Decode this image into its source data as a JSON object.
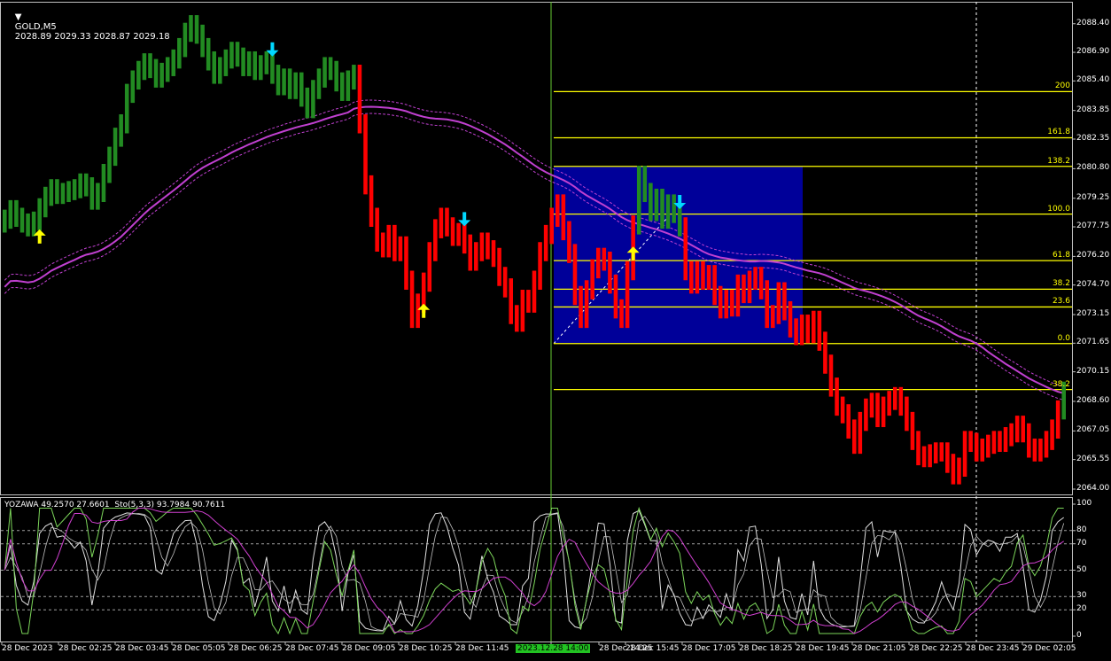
{
  "header": {
    "symbol": "GOLD,M5",
    "ohlc": "2028.89 2029.33 2028.87 2029.18"
  },
  "indicator_header": "YOZAWA 49.2570 27.6601  Sto(5,3,3) 93.7984 90.7611",
  "price_axis": [
    "2088.40",
    "2086.90",
    "2085.40",
    "2083.85",
    "2082.35",
    "2080.80",
    "2079.25",
    "2077.75",
    "2076.20",
    "2074.70",
    "2073.15",
    "2071.65",
    "2070.15",
    "2068.60",
    "2067.05",
    "2065.55",
    "2064.00"
  ],
  "osc_axis": [
    "100",
    "80",
    "70",
    "50",
    "30",
    "20",
    "0"
  ],
  "fib_levels": [
    {
      "label": "200",
      "price": 2084.84
    },
    {
      "label": "161.8",
      "price": 2082.42
    },
    {
      "label": "138.2",
      "price": 2080.92
    },
    {
      "label": "100.0",
      "price": 2078.42
    },
    {
      "label": "61.8",
      "price": 2075.98
    },
    {
      "label": "38.2",
      "price": 2074.48
    },
    {
      "label": "23.6",
      "price": 2073.55
    },
    {
      "label": "0.0",
      "price": 2071.63
    },
    {
      "label": "-38.2",
      "price": 2069.22
    }
  ],
  "time_axis": [
    "28 Dec 2023",
    "28 Dec 02:25",
    "28 Dec 03:45",
    "28 Dec 05:05",
    "28 Dec 06:25",
    "28 Dec 07:45",
    "28 Dec 09:05",
    "28 Dec 10:25",
    "28 Dec 11:45",
    "2023.12.28 14:00",
    "28 Dec 14:25",
    "28 Dec 15:45",
    "28 Dec 17:05",
    "28 Dec 18:25",
    "28 Dec 19:45",
    "28 Dec 21:05",
    "28 Dec 22:25",
    "28 Dec 23:45",
    "29 Dec 02:05"
  ],
  "colors": {
    "bull": "#228b22",
    "bear": "#ff0000",
    "ma": "#c040d0",
    "fib": "#ffff00",
    "box": "#000099",
    "vline": "#66cc33",
    "grid": "#c0c0c0"
  },
  "signals": [
    {
      "type": "buy",
      "color": "#ffff00",
      "bar": 6
    },
    {
      "type": "sell",
      "color": "#00d8ff",
      "bar": 46
    },
    {
      "type": "buy",
      "color": "#ffff00",
      "bar": 72
    },
    {
      "type": "sell",
      "color": "#00d8ff",
      "bar": 79
    },
    {
      "type": "buy",
      "color": "#ffff00",
      "bar": 108
    },
    {
      "type": "sell",
      "color": "#00d8ff",
      "bar": 116
    }
  ],
  "chart_data": {
    "type": "candlestick",
    "ylim": [
      2064.0,
      2088.9
    ],
    "osc_ylim": [
      0,
      100
    ],
    "closes": [
      2078.2,
      2078.7,
      2078.3,
      2078.0,
      2077.8,
      2078.1,
      2078.8,
      2079.4,
      2079.8,
      2079.5,
      2079.6,
      2079.7,
      2079.8,
      2080.1,
      2079.9,
      2079.2,
      2079.6,
      2080.6,
      2081.5,
      2082.5,
      2083.2,
      2084.8,
      2085.5,
      2086.0,
      2086.4,
      2086.1,
      2085.6,
      2085.9,
      2086.2,
      2086.6,
      2087.2,
      2088.0,
      2088.4,
      2087.9,
      2087.2,
      2086.5,
      2085.8,
      2086.2,
      2086.6,
      2087.0,
      2086.7,
      2086.2,
      2086.5,
      2086.0,
      2086.3,
      2086.5,
      2085.8,
      2085.2,
      2085.6,
      2085.0,
      2085.4,
      2084.6,
      2084.0,
      2085.0,
      2085.6,
      2086.2,
      2086.0,
      2085.4,
      2084.9,
      2085.5,
      2085.8,
      2083.2,
      2080.0,
      2078.3,
      2077.0,
      2076.7,
      2077.4,
      2076.5,
      2076.8,
      2075.0,
      2073.0,
      2073.8,
      2074.9,
      2076.5,
      2077.7,
      2078.3,
      2077.8,
      2077.3,
      2077.5,
      2076.9,
      2076.0,
      2076.5,
      2077.0,
      2076.6,
      2076.2,
      2075.2,
      2074.6,
      2073.2,
      2072.8,
      2074.0,
      2073.8,
      2075.0,
      2076.5,
      2077.4,
      2078.3,
      2079.0,
      2077.6,
      2076.4,
      2074.2,
      2073.0,
      2074.5,
      2075.6,
      2076.2,
      2076.0,
      2074.8,
      2073.5,
      2073.0,
      2075.5,
      2077.9,
      2080.5,
      2079.6,
      2078.6,
      2079.3,
      2078.2,
      2079.0,
      2078.5,
      2077.8,
      2075.5,
      2074.8,
      2075.5,
      2075.0,
      2075.3,
      2074.2,
      2073.5,
      2074.0,
      2073.6,
      2074.8,
      2074.3,
      2075.0,
      2075.2,
      2074.5,
      2073.0,
      2073.2,
      2074.4,
      2073.4,
      2072.5,
      2072.1,
      2072.7,
      2072.2,
      2072.9,
      2071.8,
      2070.6,
      2069.4,
      2068.4,
      2068.0,
      2067.2,
      2066.4,
      2067.6,
      2068.3,
      2068.6,
      2067.8,
      2068.4,
      2068.7,
      2068.9,
      2068.4,
      2067.6,
      2066.6,
      2065.8,
      2065.7,
      2065.9,
      2066.0,
      2066.0,
      2065.4,
      2064.8,
      2065.2,
      2066.6,
      2066.5,
      2066.0,
      2066.2,
      2066.4,
      2066.6,
      2066.5,
      2066.8,
      2067.0,
      2067.4,
      2067.0,
      2066.2,
      2066.0,
      2066.2,
      2066.6,
      2067.2,
      2068.2,
      2069.18
    ]
  }
}
